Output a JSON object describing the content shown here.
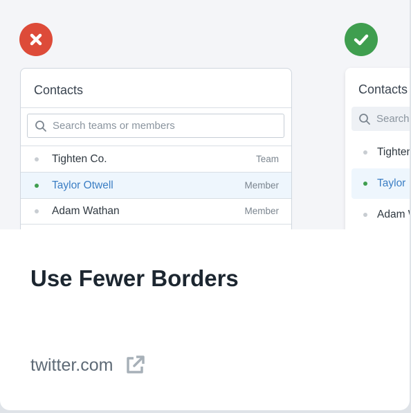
{
  "colors": {
    "bad": "#dd4b39",
    "good": "#3f9e4f",
    "active_text": "#3b7ec4"
  },
  "icons": {
    "bad": "close-icon",
    "good": "check-icon",
    "search": "search-icon",
    "external": "external-link-icon"
  },
  "bad_example": {
    "title": "Contacts",
    "search_placeholder": "Search teams or members",
    "rows": [
      {
        "name": "Tighten Co.",
        "type": "Team",
        "active": false
      },
      {
        "name": "Taylor Otwell",
        "type": "Member",
        "active": true
      },
      {
        "name": "Adam Wathan",
        "type": "Member",
        "active": false
      }
    ]
  },
  "good_example": {
    "title": "Contacts",
    "search_placeholder": "Search",
    "rows": [
      {
        "name": "Tighten",
        "active": false
      },
      {
        "name": "Taylor",
        "active": true
      },
      {
        "name": "Adam W",
        "active": false
      }
    ]
  },
  "card": {
    "title": "Use Fewer Borders",
    "domain": "twitter.com"
  }
}
